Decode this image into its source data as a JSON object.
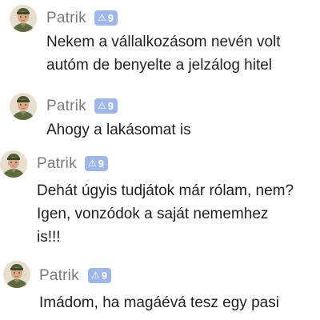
{
  "messages": [
    {
      "author": "Patrik",
      "badge": "9",
      "badge_icon": "warning-triangle-icon",
      "lines": [
        "Nekem a vállalkozásom nevén volt",
        "autóm de benyelte a jelzálog hitel"
      ]
    },
    {
      "author": "Patrik",
      "badge": "9",
      "badge_icon": "warning-triangle-icon",
      "lines": [
        "Ahogy a lakásomat is"
      ]
    },
    {
      "author": "Patrik",
      "badge": "9",
      "badge_icon": "warning-triangle-icon",
      "lines": [
        "Dehát úgyis tudjátok már rólam, nem?",
        "Igen, vonzódok a saját nememhez",
        "is!!!"
      ]
    },
    {
      "author": "Patrik",
      "badge": "9",
      "badge_icon": "warning-triangle-icon",
      "lines": [
        "Imádom, ha magáévá tesz egy pasi"
      ]
    }
  ],
  "colors": {
    "badge_bg": "#9fb7e8",
    "name": "#7a7a7a",
    "text": "#1f1f1f"
  }
}
